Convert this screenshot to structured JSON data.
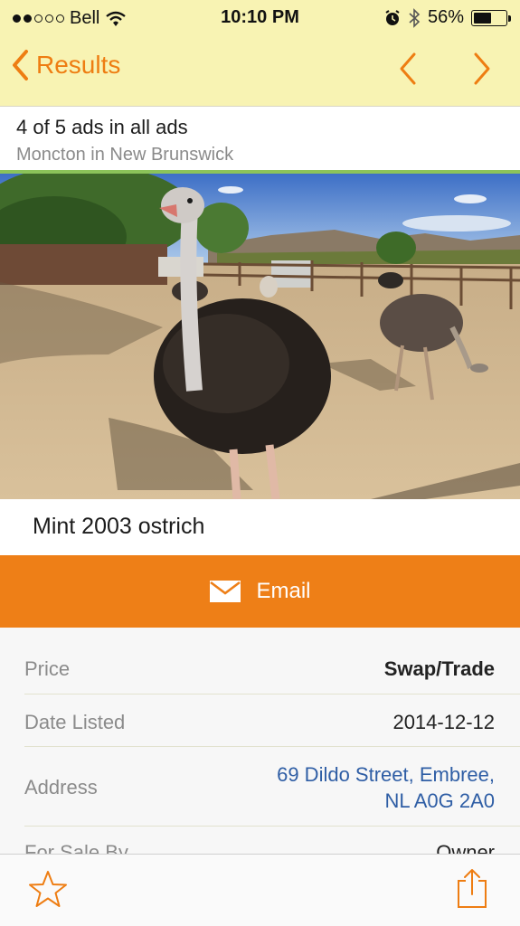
{
  "status_bar": {
    "carrier": "Bell",
    "time": "10:10 PM",
    "battery_percent": "56%",
    "battery_level": 0.56,
    "signal_bars_full": 2,
    "signal_bars_total": 5,
    "icons": [
      "wifi-icon",
      "alarm-icon",
      "bluetooth-icon",
      "battery-icon"
    ]
  },
  "nav": {
    "back_label": "Results",
    "prev_icon": "chevron-left-icon",
    "next_icon": "chevron-right-icon",
    "accent_color": "#ee7d12",
    "bar_color": "#f8f3b3"
  },
  "breadcrumb": {
    "count_text": "4 of 5 ads in all ads",
    "location_text": "Moncton in New Brunswick",
    "underline_color": "#8cc35a"
  },
  "listing": {
    "title": "Mint 2003 ostrich",
    "email_label": "Email",
    "email_color": "#ee7f17"
  },
  "details": {
    "rows": [
      {
        "label": "Price",
        "value": "Swap/Trade"
      },
      {
        "label": "Date Listed",
        "value": "2014-12-12"
      },
      {
        "label": "Address",
        "value_line1": "69 Dildo Street, Embree,",
        "value_line2": "NL A0G 2A0"
      },
      {
        "label": "For Sale By",
        "value": "Owner"
      }
    ],
    "link_color": "#2f5ea5"
  },
  "toolbar": {
    "favorite_icon": "star-icon",
    "share_icon": "share-icon"
  }
}
